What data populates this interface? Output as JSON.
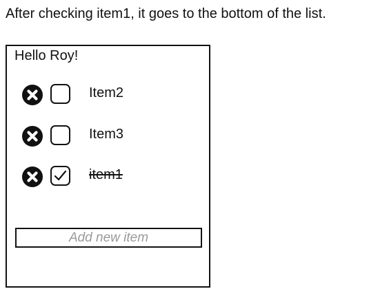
{
  "caption": "After checking item1, it goes to the bottom of the list.",
  "panel": {
    "greeting": "Hello Roy!",
    "items": [
      {
        "label": "Item2",
        "checked": false,
        "delete_icon": "x-circle-icon"
      },
      {
        "label": "Item3",
        "checked": false,
        "delete_icon": "x-circle-icon"
      },
      {
        "label": "item1",
        "checked": true,
        "delete_icon": "x-circle-icon"
      }
    ],
    "add_input": {
      "value": "",
      "placeholder": "Add new item"
    }
  },
  "colors": {
    "text": "#111111",
    "placeholder": "#9a9a9a",
    "border": "#111111",
    "background": "#ffffff"
  }
}
